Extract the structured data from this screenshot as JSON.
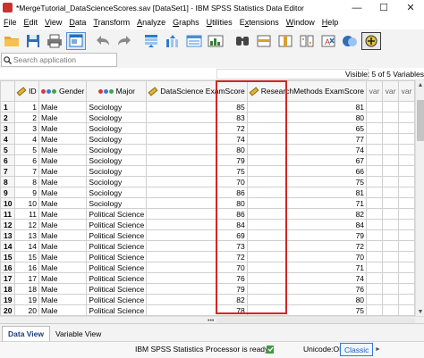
{
  "window": {
    "title": "*MergeTutorial_DataScienceScores.sav [DataSet1] - IBM SPSS Statistics Data Editor",
    "minimize_glyph": "—",
    "maximize_glyph": "☐",
    "close_glyph": "✕"
  },
  "menu": {
    "items": [
      {
        "prefix": "",
        "hot": "F",
        "rest": "ile"
      },
      {
        "prefix": "",
        "hot": "E",
        "rest": "dit"
      },
      {
        "prefix": "",
        "hot": "V",
        "rest": "iew"
      },
      {
        "prefix": "",
        "hot": "D",
        "rest": "ata"
      },
      {
        "prefix": "",
        "hot": "T",
        "rest": "ransform"
      },
      {
        "prefix": "",
        "hot": "A",
        "rest": "nalyze"
      },
      {
        "prefix": "",
        "hot": "G",
        "rest": "raphs"
      },
      {
        "prefix": "",
        "hot": "U",
        "rest": "tilities"
      },
      {
        "prefix": "E",
        "hot": "x",
        "rest": "tensions"
      },
      {
        "prefix": "",
        "hot": "W",
        "rest": "indow"
      },
      {
        "prefix": "",
        "hot": "H",
        "rest": "elp"
      }
    ]
  },
  "toolbar": {
    "buttons": [
      {
        "name": "open-data-document-icon",
        "color": "#e9a52c"
      },
      {
        "name": "save-document-icon",
        "color": "#2f6db6"
      },
      {
        "name": "print-icon",
        "color": "#555555"
      },
      {
        "name": "recall-dialog-icon",
        "color": "#1f6fc0"
      },
      {
        "name": "undo-icon",
        "color": "#8a8a8a"
      },
      {
        "name": "redo-icon",
        "color": "#8a8a8a"
      },
      {
        "name": "go-to-case-icon",
        "color": "#2b7bd1"
      },
      {
        "name": "go-to-variable-icon",
        "color": "#2b7bd1"
      },
      {
        "name": "variables-icon",
        "color": "#4a8bd4"
      },
      {
        "name": "run-descriptives-icon",
        "color": "#3a7d3a"
      },
      {
        "name": "find-icon",
        "color": "#444444"
      },
      {
        "name": "insert-cases-icon",
        "color": "#d9a036"
      },
      {
        "name": "insert-variable-icon",
        "color": "#d9a036"
      },
      {
        "name": "split-file-icon",
        "color": "#d9a036"
      },
      {
        "name": "weight-cases-icon",
        "color": "#b23b3b"
      },
      {
        "name": "value-labels-icon",
        "color": "#2f6db6"
      },
      {
        "name": "use-variable-sets-icon",
        "color": "#e2c23a"
      }
    ]
  },
  "search": {
    "placeholder": "Search application"
  },
  "visible_info": "Visible: 5 of 5 Variables",
  "grid": {
    "columns": [
      {
        "label": "ID",
        "kind": "scale"
      },
      {
        "label": "Gender",
        "kind": "nominal"
      },
      {
        "label": "Major",
        "kind": "nominal"
      },
      {
        "label": "DataScience ExamScore",
        "kind": "scale"
      },
      {
        "label": "ResearchMethods ExamScore",
        "kind": "scale"
      },
      {
        "label": "var",
        "kind": "empty"
      },
      {
        "label": "var",
        "kind": "empty"
      },
      {
        "label": "var",
        "kind": "empty"
      }
    ],
    "rows": [
      {
        "n": "1",
        "id": "1",
        "gender": "Male",
        "major": "Sociology",
        "ds": "85",
        "rm": "81"
      },
      {
        "n": "2",
        "id": "2",
        "gender": "Male",
        "major": "Sociology",
        "ds": "83",
        "rm": "80"
      },
      {
        "n": "3",
        "id": "3",
        "gender": "Male",
        "major": "Sociology",
        "ds": "72",
        "rm": "65"
      },
      {
        "n": "4",
        "id": "4",
        "gender": "Male",
        "major": "Sociology",
        "ds": "74",
        "rm": "77"
      },
      {
        "n": "5",
        "id": "5",
        "gender": "Male",
        "major": "Sociology",
        "ds": "80",
        "rm": "74"
      },
      {
        "n": "6",
        "id": "6",
        "gender": "Male",
        "major": "Sociology",
        "ds": "79",
        "rm": "67"
      },
      {
        "n": "7",
        "id": "7",
        "gender": "Male",
        "major": "Sociology",
        "ds": "75",
        "rm": "66"
      },
      {
        "n": "8",
        "id": "8",
        "gender": "Male",
        "major": "Sociology",
        "ds": "70",
        "rm": "75"
      },
      {
        "n": "9",
        "id": "9",
        "gender": "Male",
        "major": "Sociology",
        "ds": "86",
        "rm": "81"
      },
      {
        "n": "10",
        "id": "10",
        "gender": "Male",
        "major": "Sociology",
        "ds": "80",
        "rm": "71"
      },
      {
        "n": "11",
        "id": "11",
        "gender": "Male",
        "major": "Political Science",
        "ds": "86",
        "rm": "82"
      },
      {
        "n": "12",
        "id": "12",
        "gender": "Male",
        "major": "Political Science",
        "ds": "84",
        "rm": "84"
      },
      {
        "n": "13",
        "id": "13",
        "gender": "Male",
        "major": "Political Science",
        "ds": "69",
        "rm": "79"
      },
      {
        "n": "14",
        "id": "14",
        "gender": "Male",
        "major": "Political Science",
        "ds": "73",
        "rm": "72"
      },
      {
        "n": "15",
        "id": "15",
        "gender": "Male",
        "major": "Political Science",
        "ds": "72",
        "rm": "70"
      },
      {
        "n": "16",
        "id": "16",
        "gender": "Male",
        "major": "Political Science",
        "ds": "70",
        "rm": "71"
      },
      {
        "n": "17",
        "id": "17",
        "gender": "Male",
        "major": "Political Science",
        "ds": "76",
        "rm": "74"
      },
      {
        "n": "18",
        "id": "18",
        "gender": "Male",
        "major": "Political Science",
        "ds": "79",
        "rm": "76"
      },
      {
        "n": "19",
        "id": "19",
        "gender": "Male",
        "major": "Political Science",
        "ds": "82",
        "rm": "80"
      },
      {
        "n": "20",
        "id": "20",
        "gender": "Male",
        "major": "Political Science",
        "ds": "78",
        "rm": "75"
      }
    ]
  },
  "tabs": {
    "data_view": "Data View",
    "variable_view": "Variable View"
  },
  "status": {
    "processor": "IBM SPSS Statistics Processor is ready",
    "unicode": "Unicode:ON",
    "mode": "Classic"
  },
  "colors": {
    "highlight": "#d32626",
    "accent": "#1f5fb3"
  }
}
